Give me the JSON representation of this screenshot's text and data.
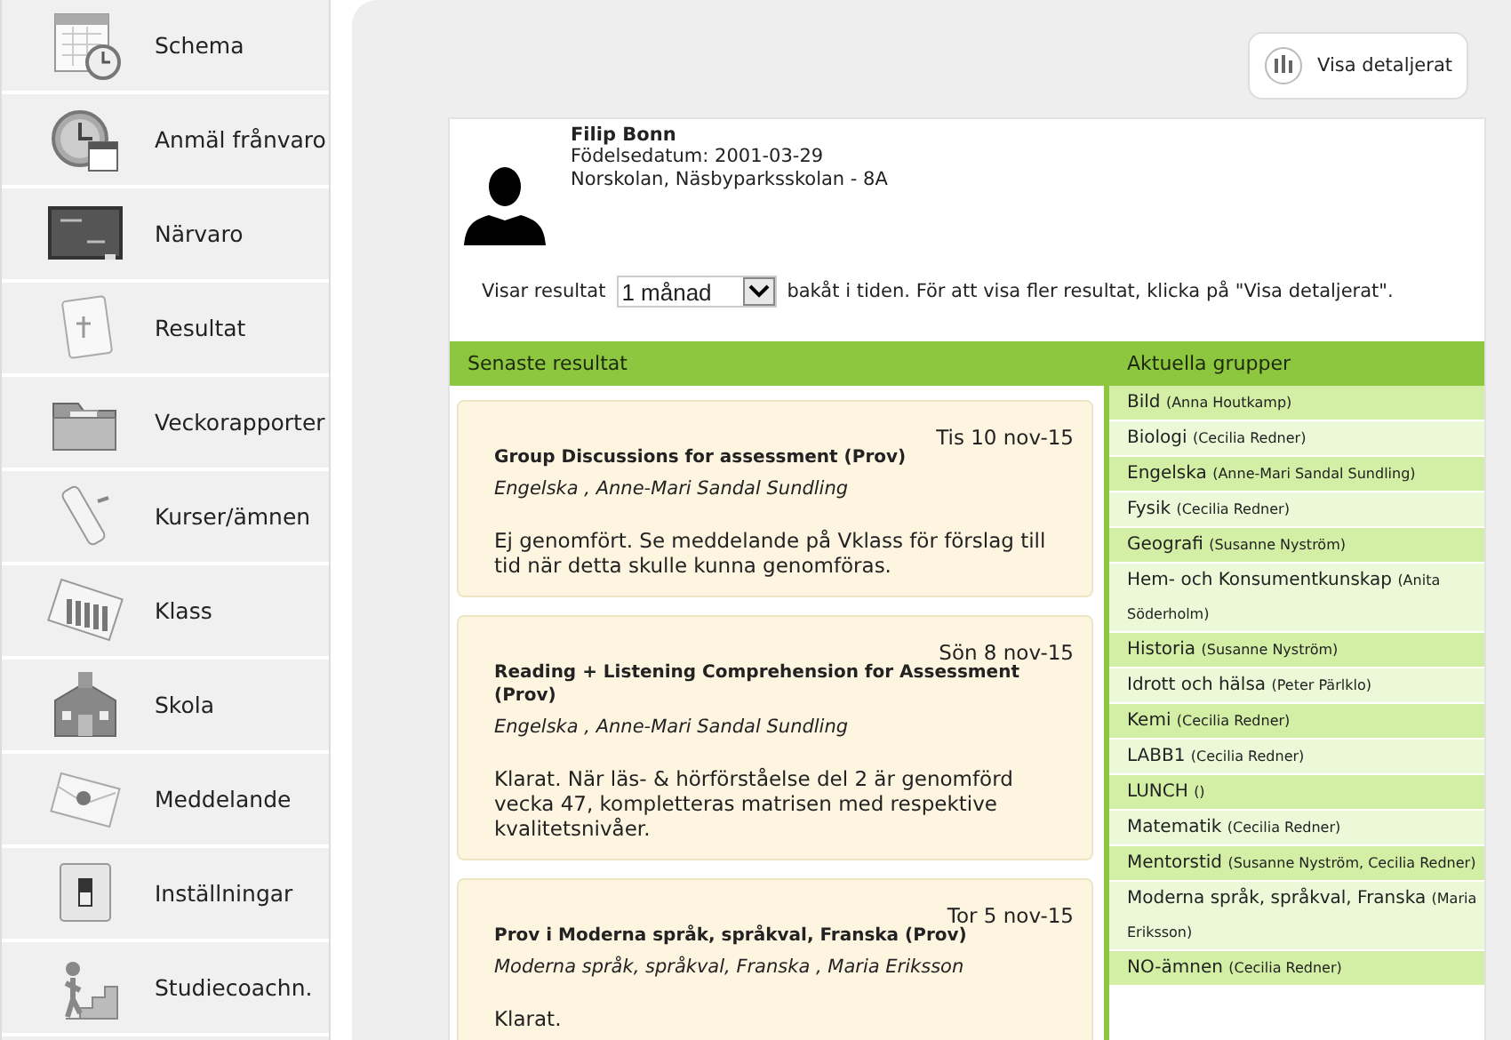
{
  "sidebar": {
    "items": [
      {
        "label": "Schema"
      },
      {
        "label": "Anmäl frånvaro"
      },
      {
        "label": "Närvaro"
      },
      {
        "label": "Resultat"
      },
      {
        "label": "Veckorapporter"
      },
      {
        "label": "Kurser/ämnen"
      },
      {
        "label": "Klass"
      },
      {
        "label": "Skola"
      },
      {
        "label": "Meddelande"
      },
      {
        "label": "Inställningar"
      },
      {
        "label": "Studiecoachn."
      }
    ]
  },
  "detail_button": {
    "label": "Visa detaljerat"
  },
  "student": {
    "name": "Filip Bonn",
    "birthdate": "Födelsedatum: 2001-03-29",
    "school": "Norskolan, Näsbyparksskolan - 8A"
  },
  "filter": {
    "prefix": "Visar resultat",
    "period": "1 månad",
    "suffix": "bakåt i tiden. För att visa fler resultat, klicka på \"Visa detaljerat\"."
  },
  "results": {
    "heading": "Senaste resultat",
    "items": [
      {
        "date": "Tis 10 nov-15",
        "title": "Group Discussions for assessment (Prov)",
        "subject": "Engelska , Anne-Mari Sandal Sundling",
        "comment": "Ej genomfört. Se meddelande på Vklass för förslag till tid när detta skulle kunna genomföras."
      },
      {
        "date": "Sön 8 nov-15",
        "title": "Reading + Listening Comprehension for Assessment (Prov)",
        "subject": "Engelska , Anne-Mari Sandal Sundling",
        "comment": "Klarat. När läs- & hörförståelse del 2 är genomförd vecka 47, kompletteras matrisen med respektive kvalitetsnivåer."
      },
      {
        "date": "Tor 5 nov-15",
        "title": "Prov i Moderna språk, språkval, Franska (Prov)",
        "subject": "Moderna språk, språkval, Franska , Maria Eriksson",
        "comment": "Klarat."
      }
    ]
  },
  "groups": {
    "heading": "Aktuella grupper",
    "items": [
      {
        "name": "Bild",
        "teacher": "(Anna Houtkamp)"
      },
      {
        "name": "Biologi",
        "teacher": "(Cecilia Redner)"
      },
      {
        "name": "Engelska",
        "teacher": "(Anne-Mari Sandal Sundling)"
      },
      {
        "name": "Fysik",
        "teacher": "(Cecilia Redner)"
      },
      {
        "name": "Geografi",
        "teacher": "(Susanne Nyström)"
      },
      {
        "name": "Hem- och Konsumentkunskap",
        "teacher": "(Anita Söderholm)"
      },
      {
        "name": "Historia",
        "teacher": "(Susanne Nyström)"
      },
      {
        "name": "Idrott och hälsa",
        "teacher": "(Peter Pärlklo)"
      },
      {
        "name": "Kemi",
        "teacher": "(Cecilia Redner)"
      },
      {
        "name": "LABB1",
        "teacher": "(Cecilia Redner)"
      },
      {
        "name": "LUNCH",
        "teacher": "()"
      },
      {
        "name": "Matematik",
        "teacher": "(Cecilia Redner)"
      },
      {
        "name": "Mentorstid",
        "teacher": "(Susanne Nyström, Cecilia Redner)"
      },
      {
        "name": "Moderna språk, språkval, Franska",
        "teacher": "(Maria Eriksson)"
      },
      {
        "name": "NO-ämnen",
        "teacher": "(Cecilia Redner)"
      }
    ]
  }
}
